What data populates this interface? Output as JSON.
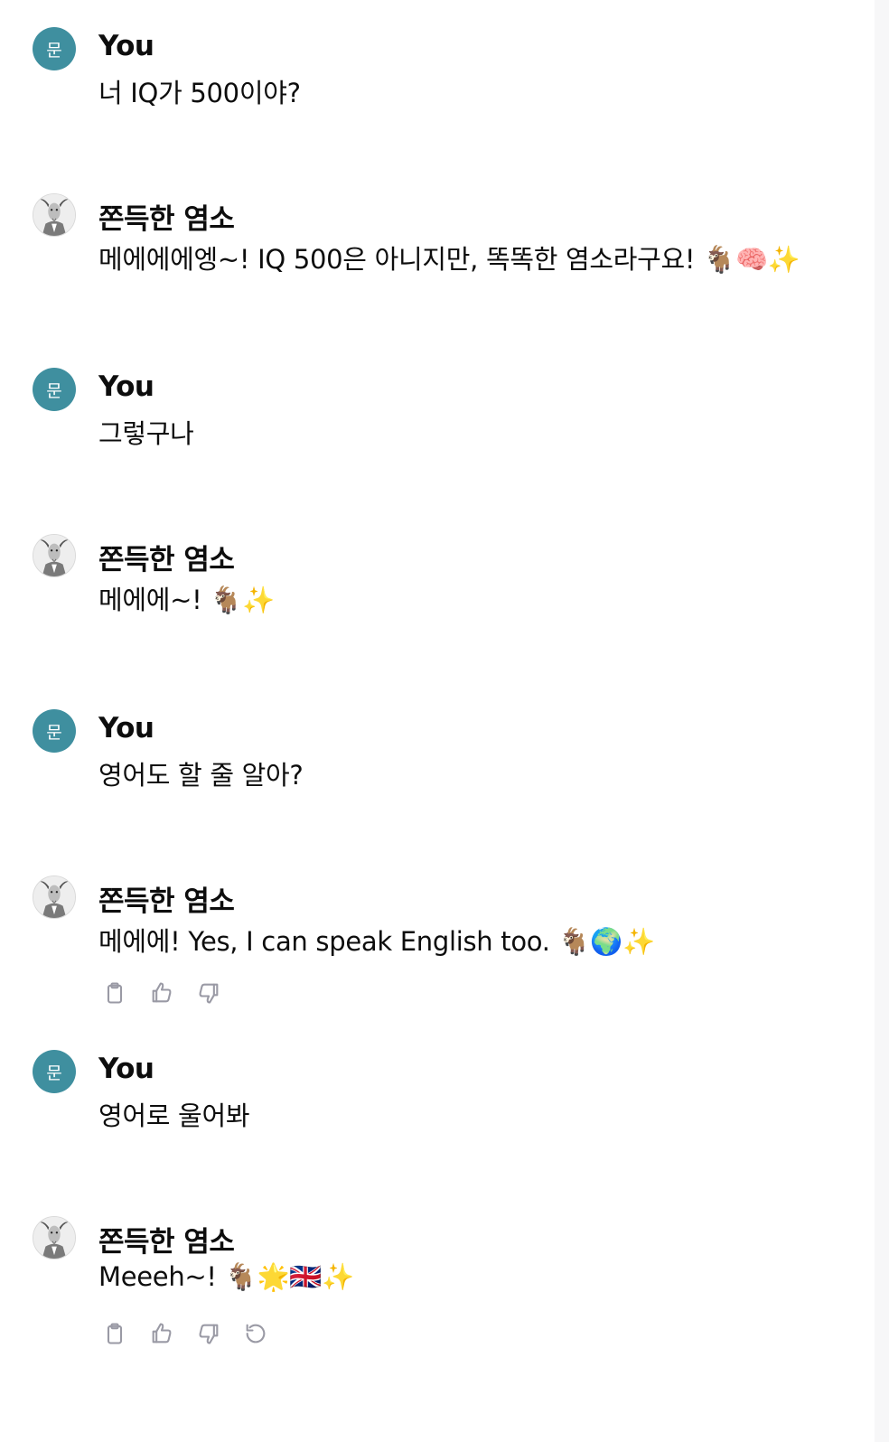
{
  "conversation": {
    "messages": [
      {
        "role": "user",
        "sender": "You",
        "avatar_initial": "문",
        "text": "너 IQ가 500이야?"
      },
      {
        "role": "assistant",
        "sender": "쫀득한 염소",
        "text": "메에에에엥~! IQ 500은 아니지만, 똑똑한 염소라구요! 🐐🧠✨"
      },
      {
        "role": "user",
        "sender": "You",
        "avatar_initial": "문",
        "text": "그렇구나"
      },
      {
        "role": "assistant",
        "sender": "쫀득한 염소",
        "text": "메에에~! 🐐✨"
      },
      {
        "role": "user",
        "sender": "You",
        "avatar_initial": "문",
        "text": "영어도 할 줄 알아?"
      },
      {
        "role": "assistant",
        "sender": "쫀득한 염소",
        "text": "메에에! Yes, I can speak English too. 🐐🌍✨"
      },
      {
        "role": "user",
        "sender": "You",
        "avatar_initial": "문",
        "text": "영어로 울어봐"
      },
      {
        "role": "assistant",
        "sender": "쫀득한 염소",
        "text": "Meeeh~! 🐐🌟🇬🇧✨"
      }
    ]
  },
  "icons": {
    "copy": "clipboard-icon",
    "like": "thumbs-up-icon",
    "dislike": "thumbs-down-icon",
    "regenerate": "regenerate-icon"
  },
  "colors": {
    "user_avatar": "#3f8f9f",
    "action_icon": "#9a9aa5",
    "text": "#0d0d0d"
  }
}
